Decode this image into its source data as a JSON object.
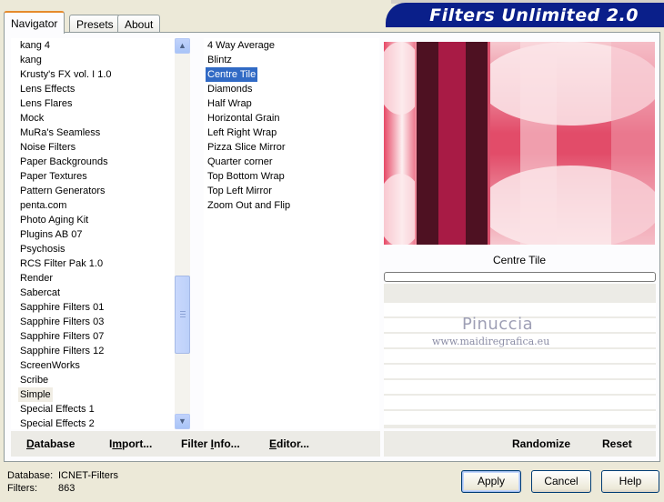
{
  "tabs": [
    {
      "label": "Navigator",
      "active": true
    },
    {
      "label": "Presets",
      "active": false
    },
    {
      "label": "About",
      "active": false
    }
  ],
  "banner": {
    "title": "Filters Unlimited 2.0"
  },
  "categories": [
    "kang 4",
    "kang",
    "Krusty's FX vol. I 1.0",
    "Lens Effects",
    "Lens Flares",
    "Mock",
    "MuRa's Seamless",
    "Noise Filters",
    "Paper Backgrounds",
    "Paper Textures",
    "Pattern Generators",
    "penta.com",
    "Photo Aging Kit",
    "Plugins AB 07",
    "Psychosis",
    "RCS Filter Pak 1.0",
    "Render",
    "Sabercat",
    "Sapphire Filters 01",
    "Sapphire Filters 03",
    "Sapphire Filters 07",
    "Sapphire Filters 12",
    "ScreenWorks",
    "Scribe",
    "Simple",
    "Special Effects 1",
    "Special Effects 2"
  ],
  "selected_category": "Simple",
  "filters": [
    "4 Way Average",
    "Blintz",
    "Centre Tile",
    "Diamonds",
    "Half Wrap",
    "Horizontal Grain",
    "Left Right Wrap",
    "Pizza Slice Mirror",
    "Quarter corner",
    "Top Bottom Wrap",
    "Top Left Mirror",
    "Zoom Out and Flip"
  ],
  "selected_filter": "Centre Tile",
  "preview": {
    "filter_name": "Centre Tile",
    "progress": 0
  },
  "watermark": {
    "name": "Pinuccia",
    "site": "www.maidiregrafica.eu"
  },
  "left_toolbar": {
    "database": {
      "u": "D",
      "rest": "atabase"
    },
    "import": {
      "pre": "I",
      "u": "m",
      "rest": "port..."
    },
    "filter_info": {
      "pre": "Filter ",
      "u": "I",
      "rest": "nfo..."
    },
    "editor": {
      "u": "E",
      "rest": "ditor..."
    }
  },
  "right_toolbar": {
    "randomize": "Randomize",
    "reset": "Reset"
  },
  "status": {
    "database_label": "Database:",
    "database_value": "ICNET-Filters",
    "filters_label": "Filters:",
    "filters_value": "863"
  },
  "buttons": {
    "apply": "Apply",
    "cancel": "Cancel",
    "help": "Help"
  },
  "colors": {
    "selection": "#316ac5",
    "banner": "#0a1f8a",
    "tab_highlight": "#e68b2c"
  }
}
